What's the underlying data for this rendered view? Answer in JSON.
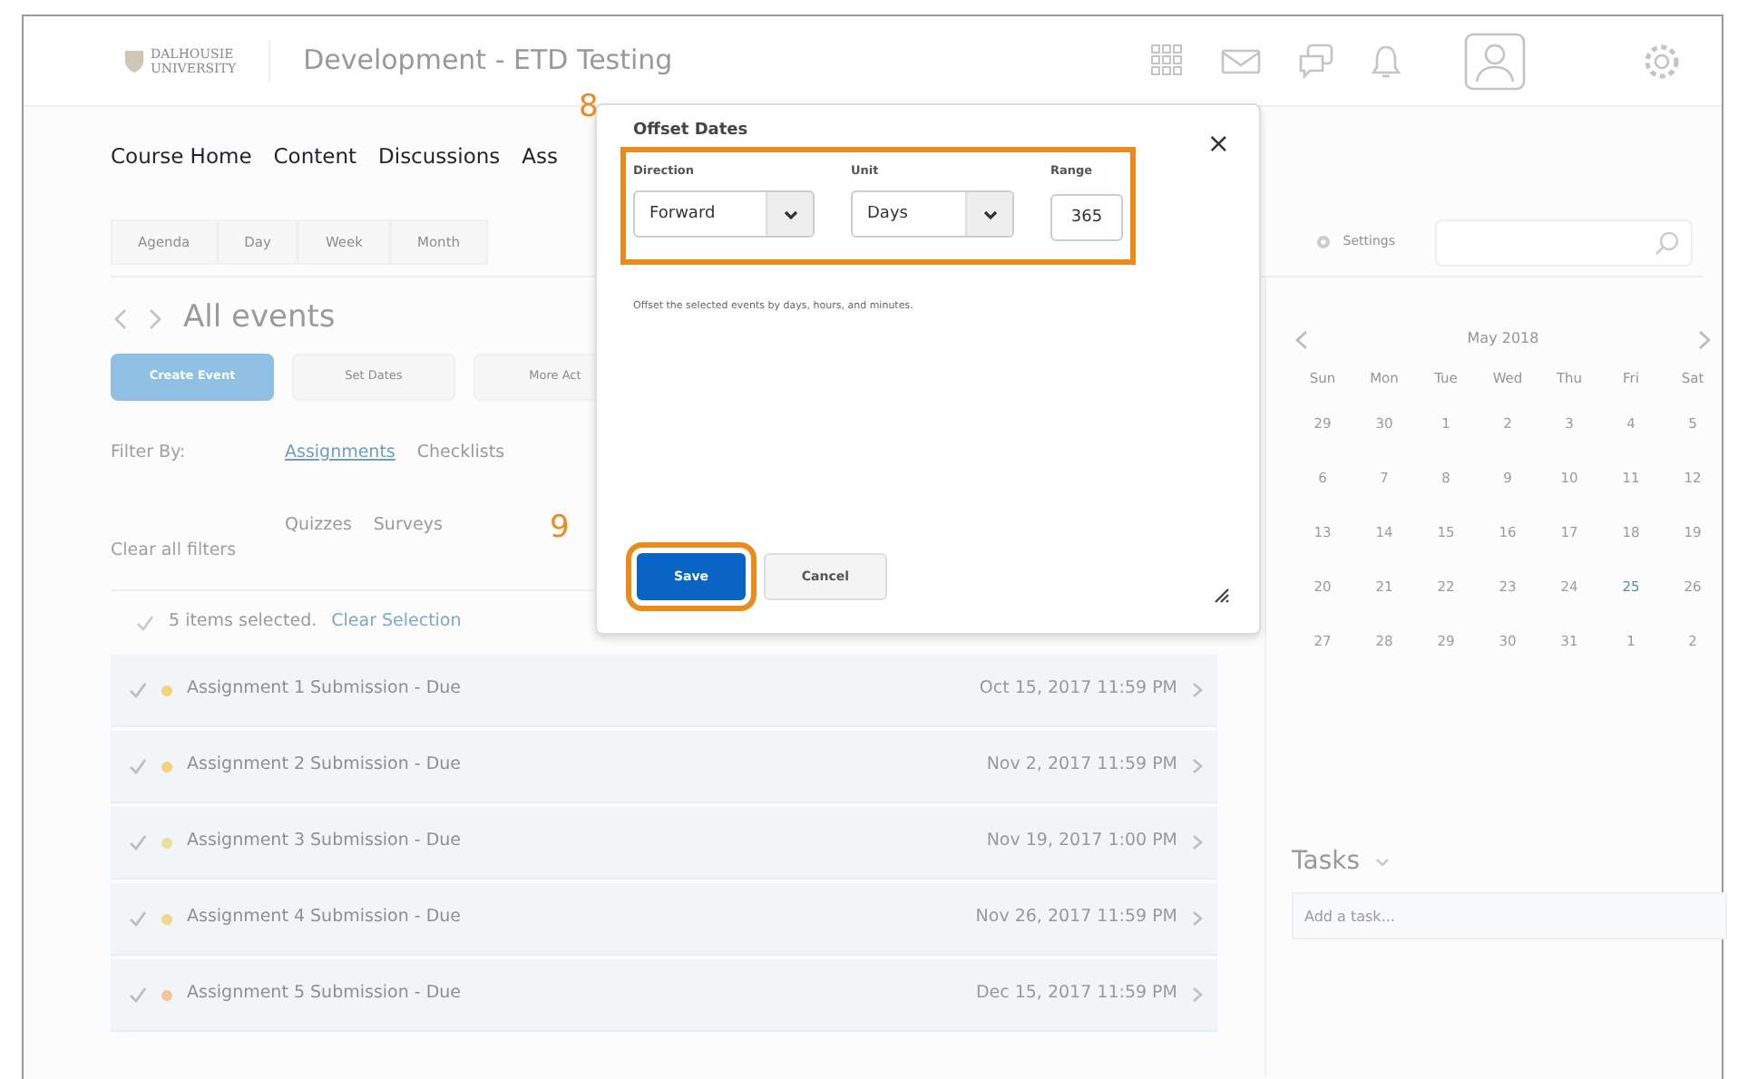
{
  "header": {
    "logo_lines": [
      "DALHOUSIE",
      "UNIVERSITY"
    ],
    "course_title": "Development - ETD Testing"
  },
  "nav": [
    "Course Home",
    "Content",
    "Discussions",
    "Ass"
  ],
  "view_tabs": [
    "Agenda",
    "Day",
    "Week",
    "Month"
  ],
  "settings_label": "Settings",
  "events": {
    "title": "All events"
  },
  "actions": [
    {
      "label": "Create Event",
      "kind": "primary"
    },
    {
      "label": "Set Dates",
      "kind": "secondary"
    },
    {
      "label": "More Act",
      "kind": "secondary"
    }
  ],
  "filter": {
    "label": "Filter By:",
    "options": [
      {
        "label": "Assignments",
        "selected": true
      },
      {
        "label": "Checklists",
        "selected": false
      },
      {
        "label": "Quizzes",
        "selected": false
      },
      {
        "label": "Surveys",
        "selected": false
      }
    ],
    "clear": "Clear all filters"
  },
  "selection": {
    "count_text": "5 items selected.",
    "clear": "Clear Selection"
  },
  "rows": [
    {
      "title": "Assignment 1 Submission - Due",
      "date": "Oct 15, 2017 11:59 PM",
      "selected": true,
      "color": "#f2d27c"
    },
    {
      "title": "Assignment 2 Submission - Due",
      "date": "Nov 2, 2017 11:59 PM",
      "selected": true,
      "color": "#f2d27c"
    },
    {
      "title": "Assignment 3 Submission - Due",
      "date": "Nov 19, 2017 1:00 PM",
      "selected": true,
      "color": "#e6e29c"
    },
    {
      "title": "Assignment 4 Submission - Due",
      "date": "Nov 26, 2017 11:59 PM",
      "selected": true,
      "color": "#eed68a"
    },
    {
      "title": "Assignment 5 Submission - Due",
      "date": "Dec 15, 2017 11:59 PM",
      "selected": true,
      "color": "#f2c49c"
    }
  ],
  "calendar": {
    "month": "May 2018",
    "weekdays": [
      "Sun",
      "Mon",
      "Tue",
      "Wed",
      "Thu",
      "Fri",
      "Sat"
    ],
    "weeks": [
      [
        {
          "d": "29",
          "today": false
        },
        {
          "d": "30",
          "today": false
        },
        {
          "d": "1",
          "today": false
        },
        {
          "d": "2",
          "today": false
        },
        {
          "d": "3",
          "today": false
        },
        {
          "d": "4",
          "today": false
        },
        {
          "d": "5",
          "today": false
        }
      ],
      [
        {
          "d": "6",
          "today": false
        },
        {
          "d": "7",
          "today": false
        },
        {
          "d": "8",
          "today": false
        },
        {
          "d": "9",
          "today": false
        },
        {
          "d": "10",
          "today": false
        },
        {
          "d": "11",
          "today": false
        },
        {
          "d": "12",
          "today": false
        }
      ],
      [
        {
          "d": "13",
          "today": false
        },
        {
          "d": "14",
          "today": false
        },
        {
          "d": "15",
          "today": false
        },
        {
          "d": "16",
          "today": false
        },
        {
          "d": "17",
          "today": false
        },
        {
          "d": "18",
          "today": false
        },
        {
          "d": "19",
          "today": false
        }
      ],
      [
        {
          "d": "20",
          "today": false
        },
        {
          "d": "21",
          "today": false
        },
        {
          "d": "22",
          "today": false
        },
        {
          "d": "23",
          "today": false
        },
        {
          "d": "24",
          "today": false
        },
        {
          "d": "25",
          "today": true
        },
        {
          "d": "26",
          "today": false
        }
      ],
      [
        {
          "d": "27",
          "today": false
        },
        {
          "d": "28",
          "today": false
        },
        {
          "d": "29",
          "today": false
        },
        {
          "d": "30",
          "today": false
        },
        {
          "d": "31",
          "today": false
        },
        {
          "d": "1",
          "today": false
        },
        {
          "d": "2",
          "today": false
        }
      ]
    ]
  },
  "tasks": {
    "title": "Tasks",
    "placeholder": "Add a task..."
  },
  "dialog": {
    "title": "Offset Dates",
    "close": "×",
    "fields_callout": "8",
    "fields": [
      {
        "label": "Direction",
        "kind": "select",
        "value": "Forward"
      },
      {
        "label": "Unit",
        "kind": "select",
        "value": "Days"
      },
      {
        "label": "Range",
        "kind": "input",
        "value": "365"
      }
    ],
    "help": "Offset the selected events by days, hours, and minutes.",
    "buttons": [
      {
        "label": "Save",
        "kind": "primary",
        "callout": "9"
      },
      {
        "label": "Cancel",
        "kind": "secondary"
      }
    ]
  }
}
